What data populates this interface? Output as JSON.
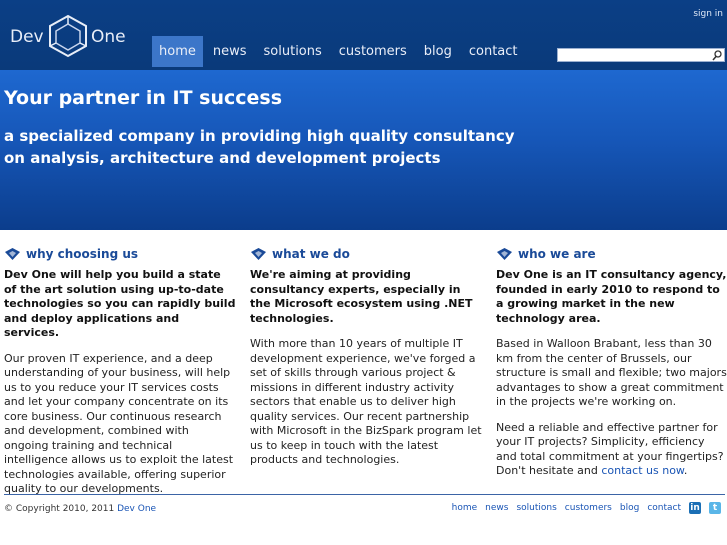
{
  "header": {
    "logo_left": "Dev",
    "logo_right": "One",
    "sign_in": "sign in",
    "search_icon": "search-icon"
  },
  "nav": {
    "items": [
      {
        "label": "home",
        "active": true
      },
      {
        "label": "news"
      },
      {
        "label": "solutions"
      },
      {
        "label": "customers"
      },
      {
        "label": "blog"
      },
      {
        "label": "contact"
      }
    ]
  },
  "hero": {
    "title": "Your partner in IT success",
    "subtitle": "a specialized company in providing high quality consultancy on analysis, architecture and development projects"
  },
  "columns": [
    {
      "title": "why choosing us",
      "lead": "Dev One will help you build a state of the art solution using up-to-date technologies so you can rapidly build and deploy applications and services.",
      "p1": "Our proven IT experience, and a deep understanding of your business, will help us to you reduce your IT services costs and let your company concentrate on its core business. Our continuous research and development, combined with ongoing training and technical intelligence allows us to exploit the latest technologies available, offering superior quality to our developments."
    },
    {
      "title": "what we do",
      "lead": "We're aiming at providing consultancy experts, especially in the Microsoft ecosystem using .NET technologies.",
      "p1": "With more than 10 years of multiple IT development experience, we've forged a set of skills through various project & missions in different industry activity sectors that enable us to deliver high quality services. Our recent partnership with Microsoft in the BizSpark program let us to keep in touch with the latest products and technologies."
    },
    {
      "title": "who we are",
      "lead": "Dev One is an IT consultancy agency, founded in early 2010 to respond to a growing market in the new technology area.",
      "p1": "Based in Walloon Brabant, less than 30 km from the center of Brussels, our structure is small and flexible; two majors advantages to show a great commitment in the projects we're working on.",
      "p2_text": "Need a reliable and effective partner for your IT projects? Simplicity, efficiency and total commitment at your fingertips? Don't hesitate and ",
      "p2_link": "contact us now",
      "p2_end": "."
    }
  ],
  "footer": {
    "copyright": "© Copyright 2010, 2011 ",
    "copyright_link": "Dev One",
    "links": [
      "home",
      "news",
      "solutions",
      "customers",
      "blog",
      "contact"
    ],
    "social": [
      {
        "icon": "linkedin-icon",
        "glyph": "in"
      },
      {
        "icon": "twitter-icon",
        "glyph": "t"
      }
    ]
  },
  "colors": {
    "header_bg": "#0b3f86",
    "nav_active": "#3c76c9",
    "hero_top": "#1e68d0",
    "hero_bottom": "#0b3d8c",
    "heading_blue": "#1a4a98",
    "link_blue": "#1a55b5"
  }
}
